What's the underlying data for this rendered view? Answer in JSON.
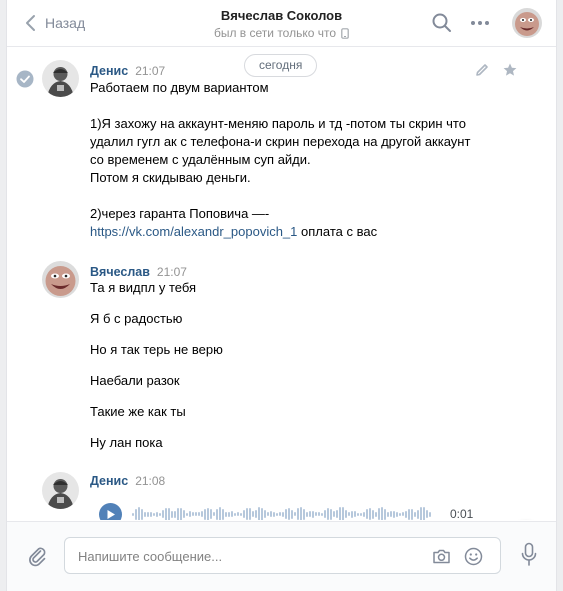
{
  "header": {
    "back_label": "Назад",
    "peer_name": "Вячеслав Соколов",
    "peer_status": "был в сети только что"
  },
  "history": {
    "date_label": "сегодня",
    "messages": [
      {
        "author": "Денис",
        "time": "21:07",
        "lines": [
          "Работаем по двум вариантом",
          "",
          "1)Я захожу на аккаунт-меняю пароль и тд -потом ты скрин что",
          "удалил гугл ак с телефона-и скрин перехода на другой аккаунт",
          "со временем с удалённым суп айди.",
          "Потом я скидываю деньги.",
          "",
          "2)через гаранта Поповича —-"
        ],
        "link_text": "https://vk.com/alexandr_popovich_1",
        "link_suffix": " оплата с вас"
      },
      {
        "author": "Вячеслав",
        "time": "21:07",
        "lines": [
          "Та я видпл у тебя",
          "Я б с радостью",
          "Но я так терь не верю",
          "Наебали разок",
          "Такие же как ты",
          "Ну лан пока"
        ]
      },
      {
        "author": "Денис",
        "time": "21:08",
        "audio": {
          "duration": "0:01"
        }
      }
    ]
  },
  "composer": {
    "placeholder": "Напишите сообщение..."
  },
  "colors": {
    "link": "#2a5885",
    "accent": "#5181b8",
    "muted": "#939393"
  }
}
